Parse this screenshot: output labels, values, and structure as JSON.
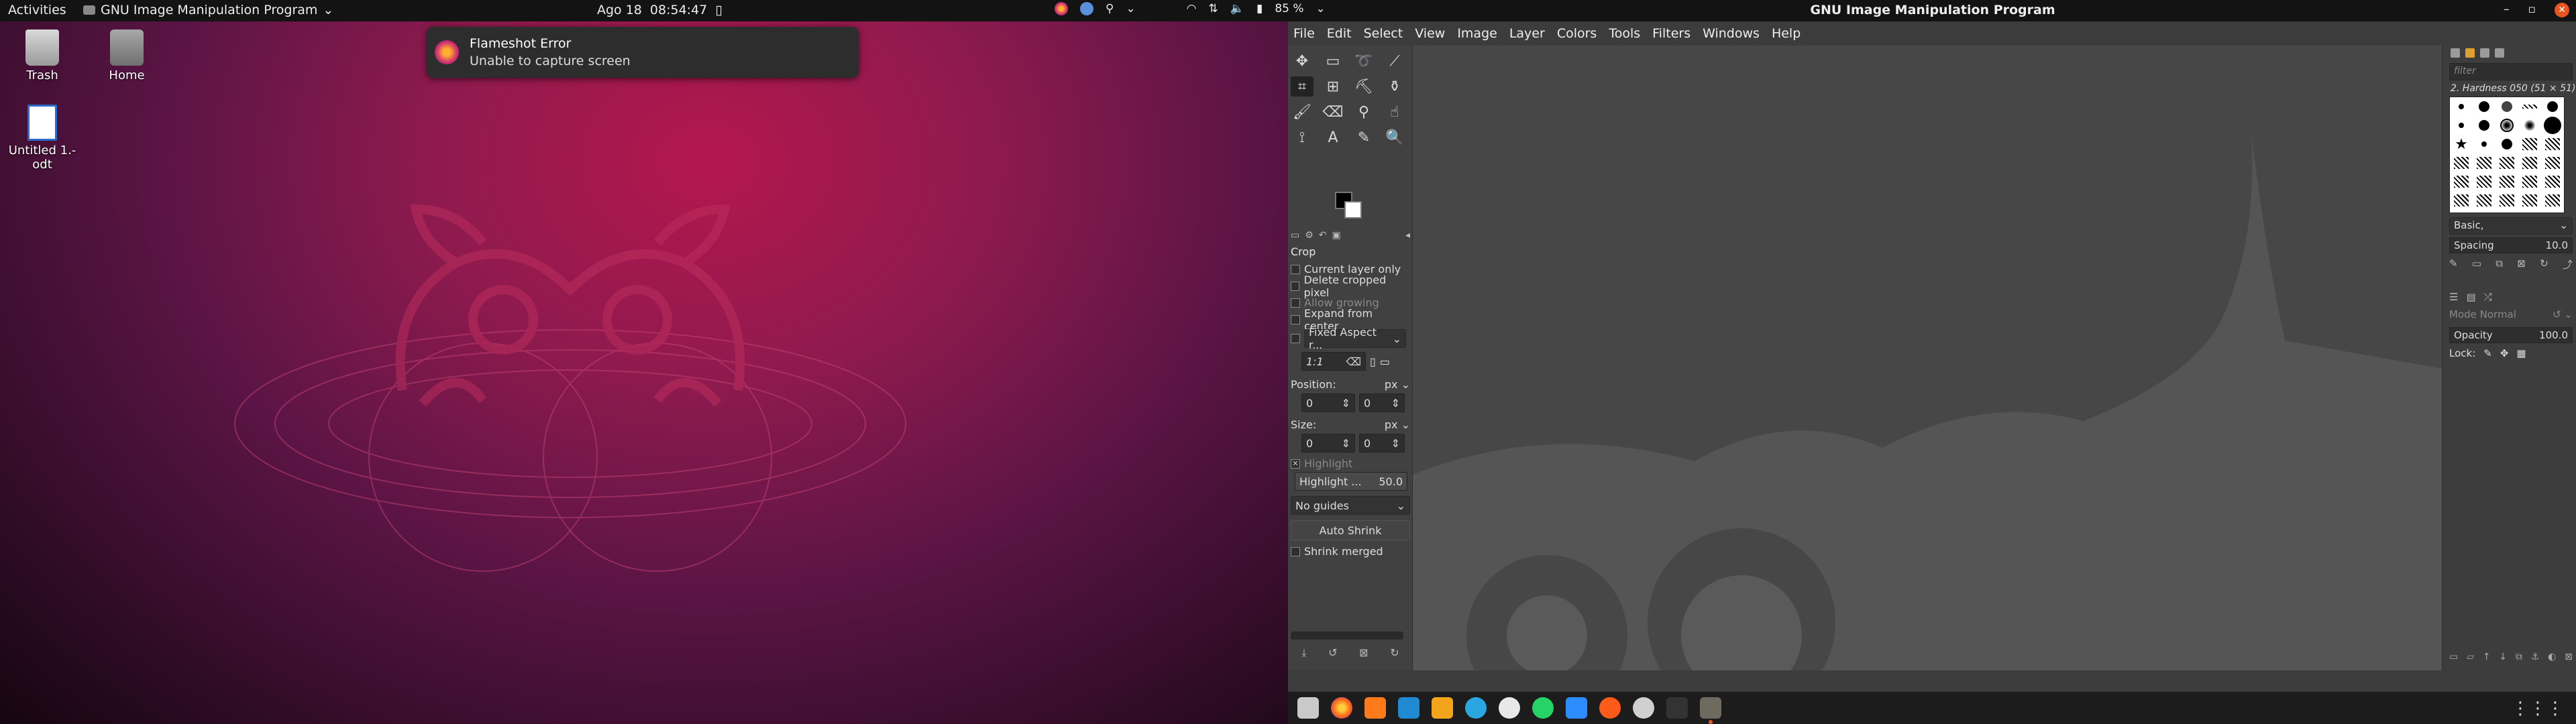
{
  "topbar": {
    "activities": "Activities",
    "app_menu": "GNU Image Manipulation Program",
    "date": "Ago 18",
    "time": "08:54:47",
    "battery": "85 %",
    "gimp_title": "GNU Image Manipulation Program"
  },
  "desktop": {
    "icons": [
      {
        "label": "Trash"
      },
      {
        "label": "Home"
      },
      {
        "label": "Untitled 1.-odt"
      }
    ]
  },
  "notification": {
    "title": "Flameshot Error",
    "body": "Unable to capture screen"
  },
  "gimp": {
    "menu": [
      "File",
      "Edit",
      "Select",
      "View",
      "Image",
      "Layer",
      "Colors",
      "Tools",
      "Filters",
      "Windows",
      "Help"
    ],
    "tool_options": {
      "title": "Crop",
      "current_layer_only": "Current layer only",
      "delete_cropped": "Delete cropped pixel",
      "allow_growing": "Allow growing",
      "expand_center": "Expand from center",
      "fixed_aspect": "Fixed Aspect r...",
      "ratio": "1:1",
      "position_label": "Position:",
      "position_unit": "px",
      "pos_x": "0",
      "pos_y": "0",
      "size_label": "Size:",
      "size_unit": "px",
      "size_w": "0",
      "size_h": "0",
      "highlight_check": "Highlight",
      "highlight_label": "Highlight ...",
      "highlight_value": "50.0",
      "guides": "No guides",
      "auto_shrink": "Auto Shrink",
      "shrink_merged": "Shrink merged"
    },
    "brushes": {
      "filter_placeholder": "filter",
      "brush_name": "2. Hardness 050 (51 × 51)",
      "set": "Basic,",
      "spacing_label": "Spacing",
      "spacing_value": "10.0"
    },
    "layers": {
      "mode": "Mode Normal",
      "opacity_label": "Opacity",
      "opacity_value": "100.0",
      "lock_label": "Lock:"
    }
  }
}
